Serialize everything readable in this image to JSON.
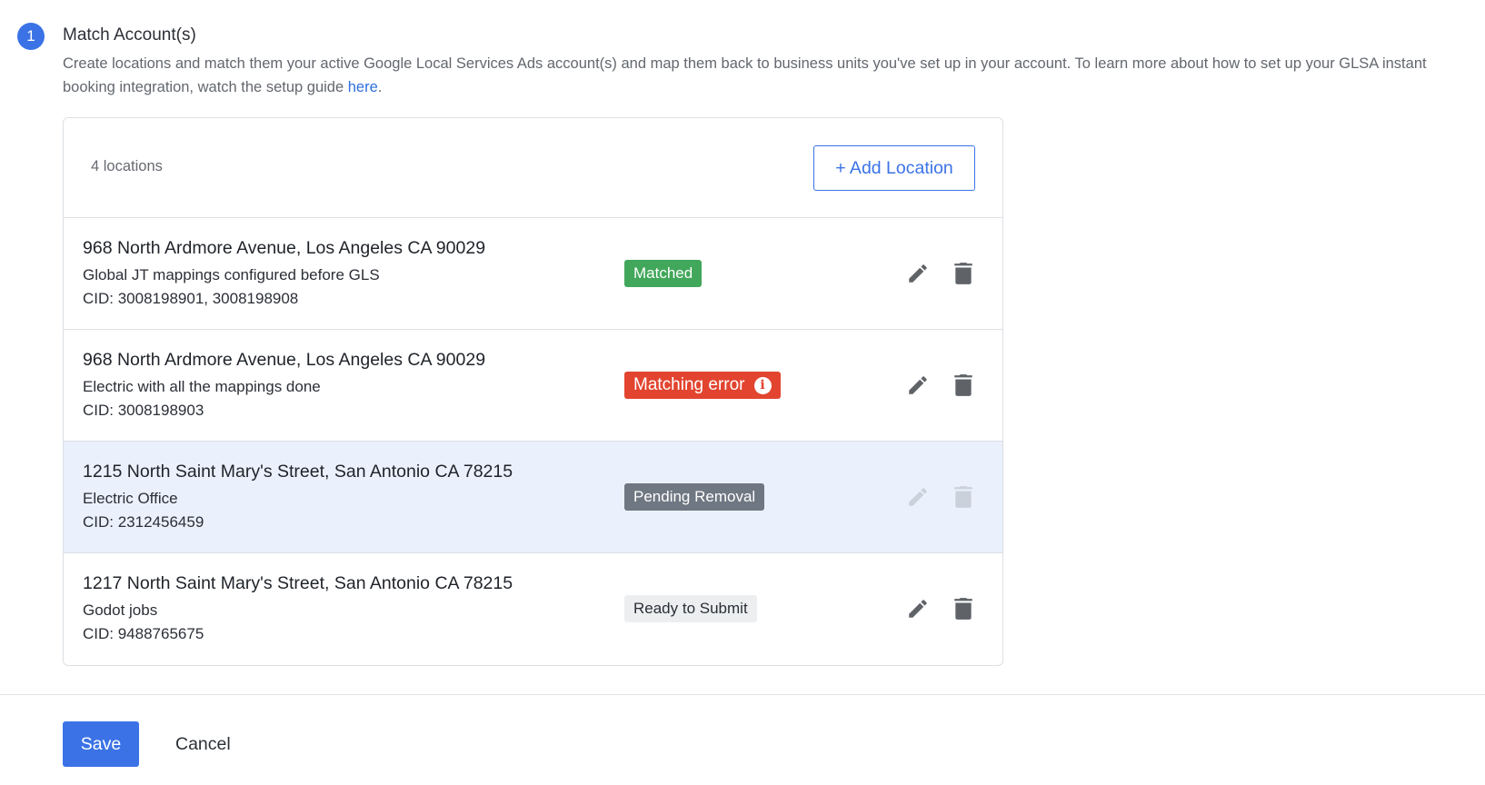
{
  "section": {
    "step_number": "1",
    "title": "Match Account(s)",
    "description_before_link": "Create locations and match them your active Google Local Services Ads account(s) and map them back to business units you've set up in your account. To learn more about how to set up your GLSA instant booking integration, watch the setup guide ",
    "link_text": "here",
    "description_after_link": "."
  },
  "locations_card": {
    "count_label": "4 locations",
    "add_button_label": "+ Add Location",
    "rows": [
      {
        "address": "968 North Ardmore Avenue, Los Angeles CA 90029",
        "description": "Global JT mappings configured before GLS",
        "cid": "CID: 3008198901, 3008198908",
        "status": "Matched",
        "status_color": "#41a75a"
      },
      {
        "address": "968 North Ardmore Avenue, Los Angeles CA 90029",
        "description": "Electric with all the mappings done",
        "cid": "CID: 3008198903",
        "status": "Matching error",
        "status_color": "#e2442f",
        "status_icon": "info-icon"
      },
      {
        "address": "1215 North Saint Mary's Street, San Antonio CA 78215",
        "description": "Electric Office",
        "cid": "CID: 2312456459",
        "status": "Pending Removal",
        "status_color": "#6f7782",
        "actions_disabled": true
      },
      {
        "address": "1217 North Saint Mary's Street, San Antonio CA 78215",
        "description": "Godot jobs",
        "cid": "CID: 9488765675",
        "status": "Ready to Submit",
        "status_color": "#eceef0"
      }
    ],
    "row_icons": [
      "pencil-icon",
      "trash-icon"
    ]
  },
  "footer": {
    "save_label": "Save",
    "cancel_label": "Cancel"
  },
  "colors": {
    "accent": "#3b73e6",
    "link": "#2f6fdd",
    "pending_row_bg": "#eaf1fc"
  }
}
